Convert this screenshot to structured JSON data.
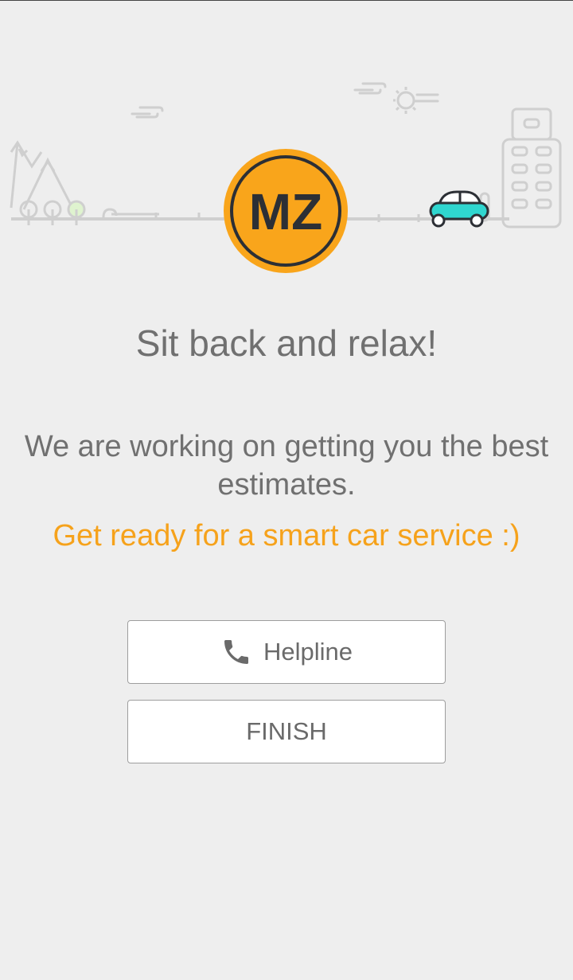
{
  "brand": {
    "logo_text": "MZ",
    "logo_color": "#f9a51b",
    "logo_ink": "#2c2f35"
  },
  "illustration": {
    "icons": [
      "mountain-icon",
      "tree-icon",
      "cloud-icon",
      "sun-icon",
      "car-icon",
      "building-icon"
    ],
    "car_color": "#2fd6cf"
  },
  "main": {
    "headline": "Sit back and relax!",
    "message": "We are working on getting you the best estimates.",
    "tagline": "Get ready for a smart car service :)",
    "tagline_color": "#f6a21b"
  },
  "actions": {
    "helpline_label": "Helpline",
    "helpline_icon": "phone-icon",
    "finish_label": "FINISH"
  }
}
